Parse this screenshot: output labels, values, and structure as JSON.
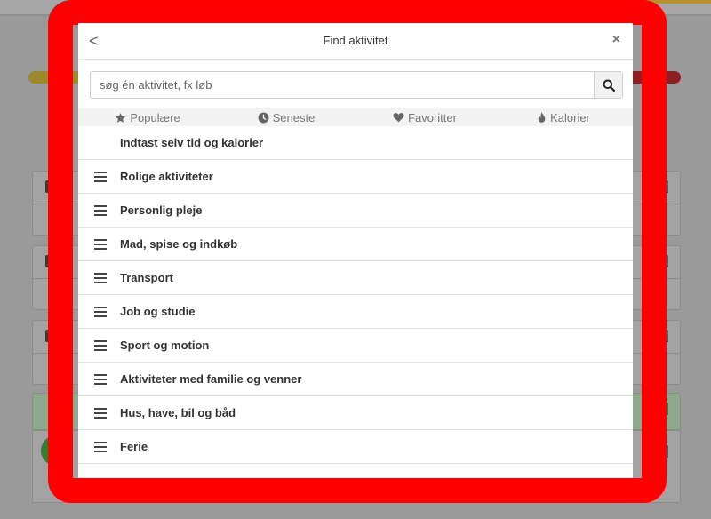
{
  "modal": {
    "back_label": "<",
    "title": "Find aktivitet",
    "close_label": "×"
  },
  "search": {
    "placeholder": "søg én aktivitet, fx løb"
  },
  "tabs": [
    {
      "label": "Populære",
      "icon": "star-icon"
    },
    {
      "label": "Seneste",
      "icon": "clock-icon"
    },
    {
      "label": "Favoritter",
      "icon": "heart-icon"
    },
    {
      "label": "Kalorier",
      "icon": "flame-icon"
    }
  ],
  "list": {
    "first_item": "Indtast selv tid og kalorier",
    "categories": [
      "Rolige aktiviteter",
      "Personlig pleje",
      "Mad, spise og indkøb",
      "Transport",
      "Job og studie",
      "Sport og motion",
      "Aktiviteter med familie og venner",
      "Hus, have, bil og båd",
      "Ferie"
    ]
  },
  "background": {
    "kcal_fragment": "al"
  },
  "colors": {
    "annotation": "#ff0000",
    "overlay": "#9a9a9a"
  }
}
